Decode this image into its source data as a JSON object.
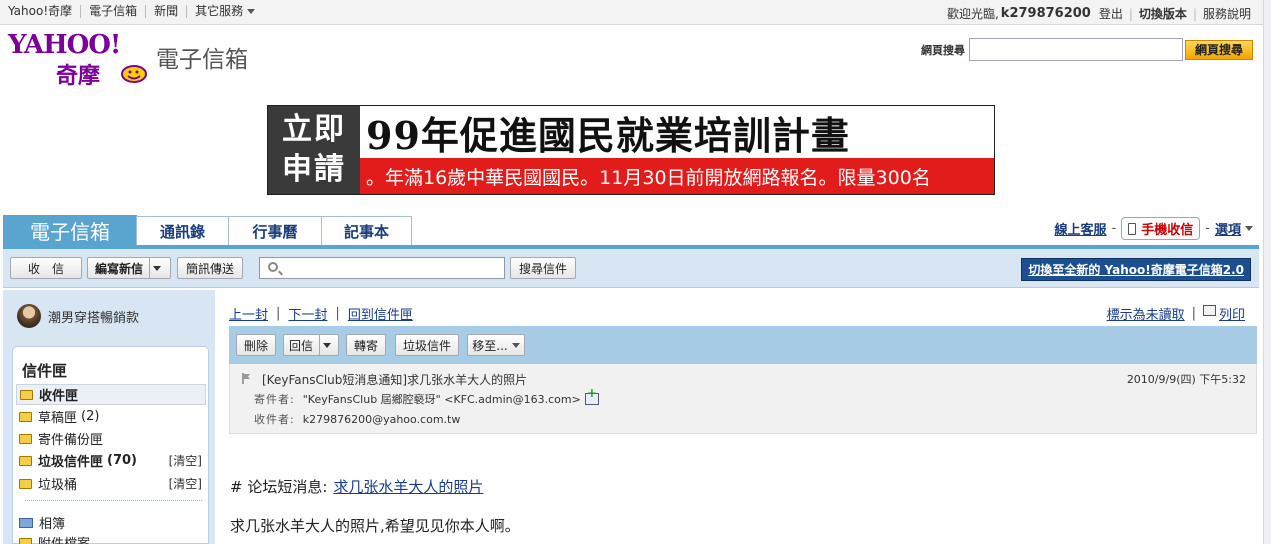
{
  "topbar": {
    "links": [
      "Yahoo!奇摩",
      "電子信箱",
      "新聞",
      "其它服務"
    ],
    "welcome": "歡迎光臨,",
    "username": "k279876200",
    "logout": "登出",
    "switch_version": "切換版本",
    "help": "服務說明"
  },
  "header": {
    "logo_yahoo": "YAHOO!",
    "logo_cn": "奇摩",
    "product": "電子信箱",
    "web_search_label": "網頁搜尋",
    "web_search_button": "網頁搜尋"
  },
  "banner": {
    "left_line1": "立即",
    "left_line2": "申請",
    "title": "99年促進國民就業培訓計畫",
    "subtitle": "。年滿16歲中華民國國民。11月30日前開放網路報名。限量300名"
  },
  "tabs": [
    "電子信箱",
    "通訊錄",
    "行事曆",
    "記事本"
  ],
  "tab_tools": {
    "support": "線上客服",
    "mobile": "手機收信",
    "options": "選項"
  },
  "toolbar": {
    "receive": "收　信",
    "compose": "編寫新信",
    "sms": "簡訊傳送",
    "search_value": "",
    "search_button": "搜尋信件",
    "switch_new": "切換至全新的 Yahoo!奇摩電子信箱2.0"
  },
  "sidebar": {
    "promo": "潮男穿搭暢銷款",
    "folders_title": "信件匣",
    "folders": [
      {
        "label": "收件匣",
        "count": "",
        "bold": true
      },
      {
        "label": "草稿匣",
        "count": "(2)",
        "bold": false
      },
      {
        "label": "寄件備份匣",
        "count": "",
        "bold": false
      },
      {
        "label": "垃圾信件匣",
        "count": "(70)",
        "bold": true,
        "clear": "[清空]"
      },
      {
        "label": "垃圾桶",
        "count": "",
        "bold": false,
        "clear": "[清空]"
      }
    ],
    "album": "相簿",
    "attachments": "附件檔案"
  },
  "message": {
    "nav": [
      "上一封",
      "下一封",
      "回到信件匣"
    ],
    "mark_unread": "標示為未讀取",
    "print": "列印",
    "actions": {
      "delete": "刪除",
      "reply": "回信",
      "forward": "轉寄",
      "spam": "垃圾信件",
      "move": "移至..."
    },
    "subject": "[KeyFansClub短消息通知]求几张水羊大人的照片",
    "date": "2010/9/9(四) 下午5:32",
    "from_label": "寄件者:",
    "from": "\"KeyFansClub 屆鄉腔褻玡\" <KFC.admin@163.com>",
    "to_label": "收件者:",
    "to": "k279876200@yahoo.com.tw",
    "body_prefix": "# 论坛短消息:",
    "body_link": "求几张水羊大人的照片",
    "body_text": "求几张水羊大人的照片,希望见见你本人啊。"
  },
  "colors": {
    "accent": "#5aa5cf",
    "toolbar_bg": "#d7e6f2",
    "action_bar": "#a9cce6",
    "brand_purple": "#7b0099"
  }
}
